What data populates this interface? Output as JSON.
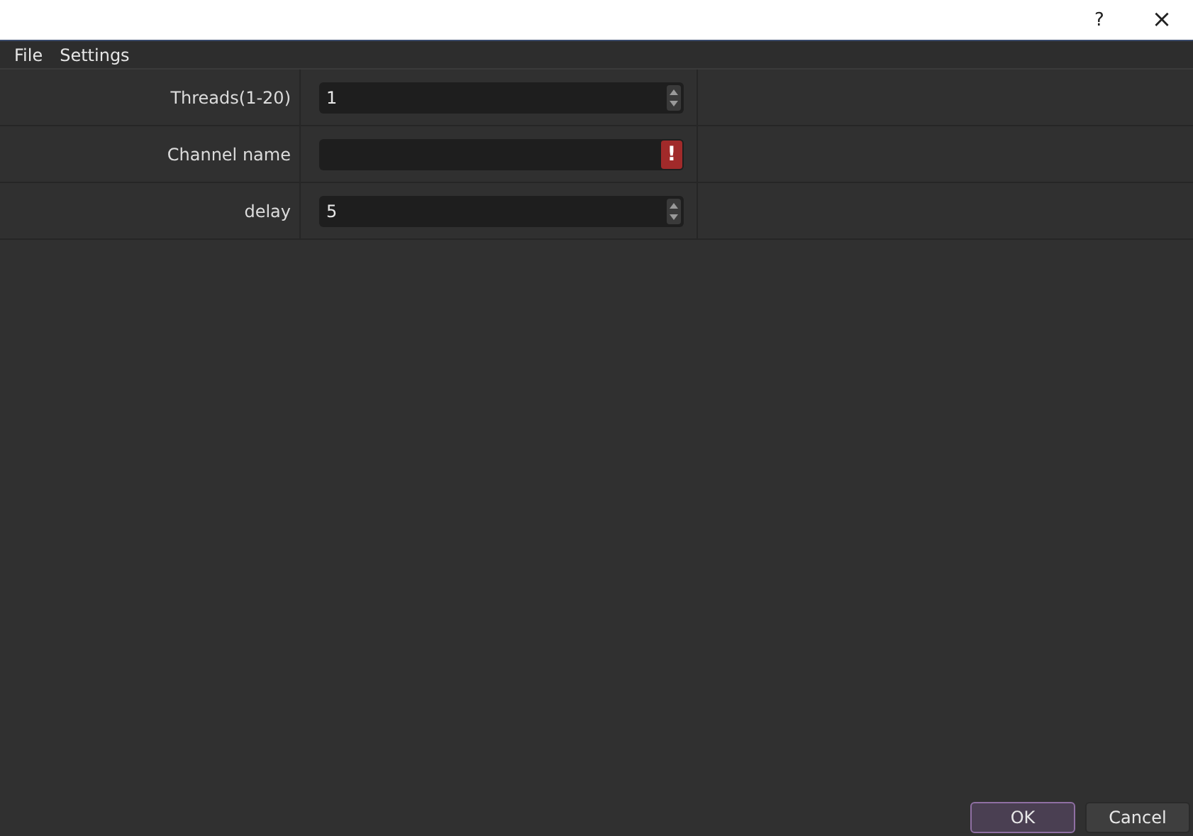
{
  "title_bar": {
    "help": "?",
    "close": "×"
  },
  "menu": [
    "File",
    "Settings"
  ],
  "fields": [
    {
      "label": "Threads(1-20)",
      "kind": "spin",
      "value": "1",
      "error": false
    },
    {
      "label": "Channel name",
      "kind": "text",
      "error": true,
      "error_mark": "!"
    },
    {
      "label": "delay",
      "kind": "spin",
      "value": "5",
      "error": false
    }
  ],
  "buttons": [
    {
      "label": "OK",
      "default": true
    },
    {
      "label": "Cancel",
      "default": false
    }
  ]
}
